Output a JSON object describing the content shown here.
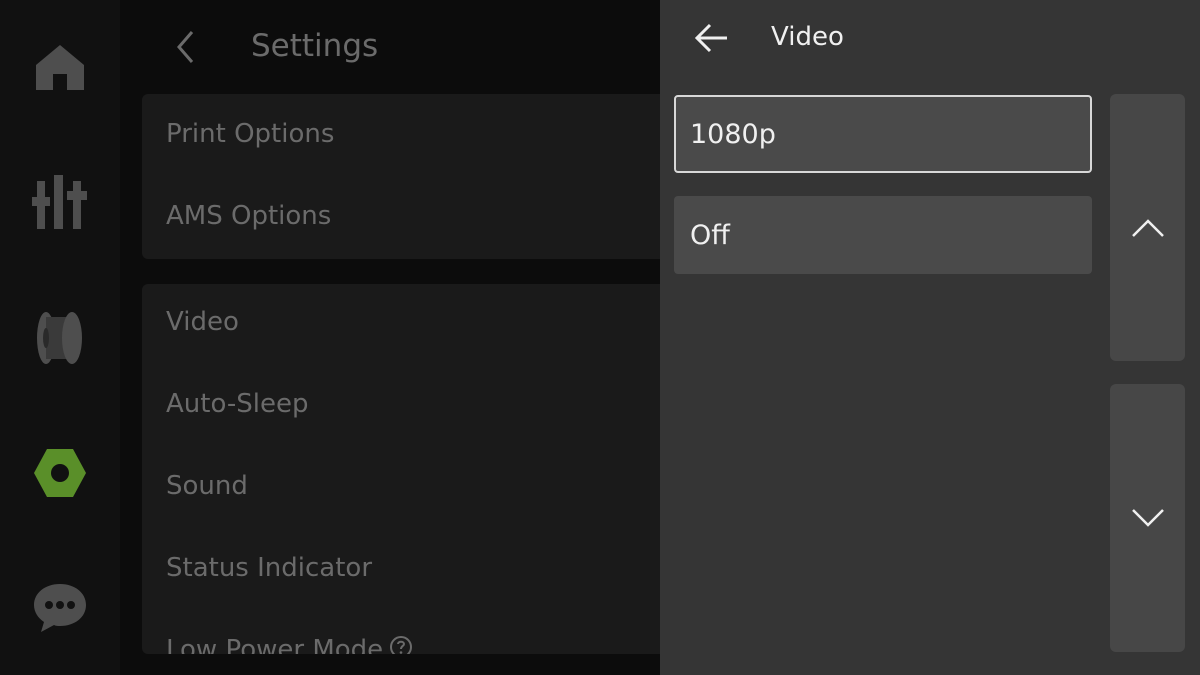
{
  "nav": {
    "items": [
      {
        "name": "home",
        "icon": "home-icon"
      },
      {
        "name": "controls",
        "icon": "sliders-icon"
      },
      {
        "name": "filament",
        "icon": "filament-spool-icon"
      },
      {
        "name": "settings",
        "icon": "settings-nut-icon",
        "active": true,
        "active_color": "#5a8f29"
      },
      {
        "name": "messages",
        "icon": "chat-bubble-icon"
      }
    ]
  },
  "settings": {
    "title": "Settings",
    "group1": [
      "Print Options",
      "AMS Options"
    ],
    "group2": [
      "Video",
      "Auto-Sleep",
      "Sound",
      "Status Indicator",
      "Low Power Mode"
    ],
    "help_icon": "question-circle-icon"
  },
  "video_panel": {
    "title": "Video",
    "options": [
      {
        "label": "1080p",
        "selected": true
      },
      {
        "label": "Off",
        "selected": false
      }
    ],
    "scroll_up_icon": "chevron-up-icon",
    "scroll_down_icon": "chevron-down-icon"
  }
}
